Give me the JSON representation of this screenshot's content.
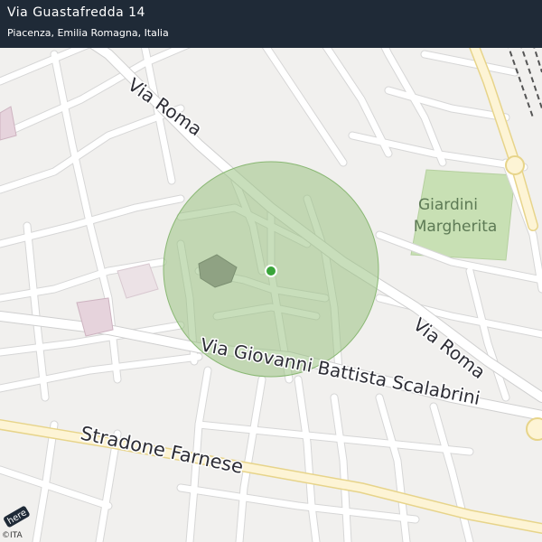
{
  "header": {
    "title": "Via Guastafredda 14",
    "subtitle": "Piacenza, Emilia Romagna, Italia"
  },
  "map": {
    "streets": {
      "via_roma_upper": "Via  Roma",
      "via_roma_lower": "Via  Roma",
      "scalabrini": "Via  Giovanni  Battista  Scalabrini",
      "farnese": "Stradone   Farnese"
    },
    "park_label_line1": "Giardini",
    "park_label_line2": "Margherita",
    "logo_text": "here",
    "copyright": "©ITA",
    "colors": {
      "background": "#f1f0ee",
      "street": "#ffffff",
      "street_casing": "#cfcfcf",
      "major_road": "#fdf4d5",
      "major_road_casing": "#e7d48a",
      "park": "#c8e0b4",
      "radius_fill": "#9bc283",
      "marker": "#3aa53a",
      "header_bg": "#1f2a37"
    }
  }
}
